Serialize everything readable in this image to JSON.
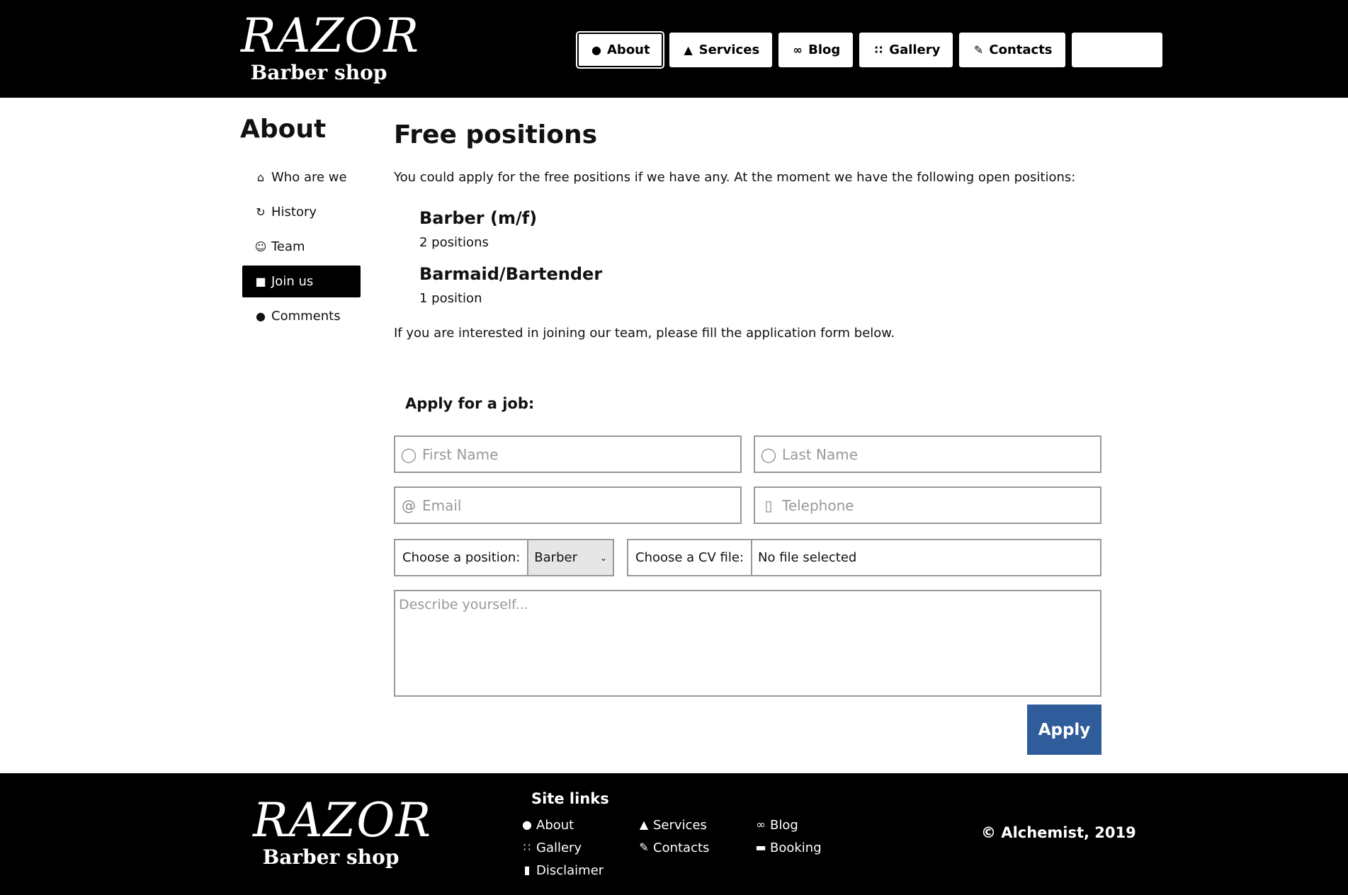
{
  "header": {
    "brand": "RAZOR",
    "subtitle": "Barber shop",
    "nav": [
      {
        "label": "About",
        "icon": "user-icon",
        "active": true
      },
      {
        "label": "Services",
        "icon": "bell-icon"
      },
      {
        "label": "Blog",
        "icon": "rss-icon"
      },
      {
        "label": "Gallery",
        "icon": "grid-icon"
      },
      {
        "label": "Contacts",
        "icon": "edit-icon"
      },
      {
        "label": "",
        "icon": ""
      }
    ]
  },
  "sidebar": {
    "title": "About",
    "items": [
      {
        "label": "Who are we",
        "icon": "home-icon"
      },
      {
        "label": "History",
        "icon": "history-icon"
      },
      {
        "label": "Team",
        "icon": "users-icon"
      },
      {
        "label": "Join us",
        "icon": "briefcase-icon",
        "active": true
      },
      {
        "label": "Comments",
        "icon": "comments-icon"
      }
    ]
  },
  "main": {
    "title": "Free positions",
    "intro": "You could apply for the free positions if we have any. At the moment we have the following open positions:",
    "positions": [
      {
        "name": "Barber (m/f)",
        "count": "2 positions"
      },
      {
        "name": "Barmaid/Bartender",
        "count": "1 position"
      }
    ],
    "outro": "If you are interested in joining our team, please fill the application form below."
  },
  "form": {
    "title": "Apply for a job:",
    "first_name_placeholder": "First Name",
    "last_name_placeholder": "Last Name",
    "email_placeholder": "Email",
    "telephone_placeholder": "Telephone",
    "position_label": "Choose a position:",
    "position_value": "Barber",
    "cv_label": "Choose a CV file:",
    "cv_value": "No file selected",
    "describe_placeholder": "Describe yourself...",
    "apply_label": "Apply"
  },
  "footer": {
    "brand": "RAZOR",
    "subtitle": "Barber shop",
    "links_title": "Site links",
    "links": [
      {
        "label": "About",
        "icon": "user-icon"
      },
      {
        "label": "Services",
        "icon": "bell-icon"
      },
      {
        "label": "Blog",
        "icon": "rss-icon"
      },
      {
        "label": "Gallery",
        "icon": "grid-icon"
      },
      {
        "label": "Contacts",
        "icon": "edit-icon"
      },
      {
        "label": "Booking",
        "icon": "ticket-icon"
      },
      {
        "label": "Disclaimer",
        "icon": "pdf-icon"
      }
    ],
    "copyright": "© Alchemist, 2019"
  },
  "colors": {
    "header_bg": "#000000",
    "apply_button": "#2f5c9a",
    "active_sidebar": "#000000"
  }
}
